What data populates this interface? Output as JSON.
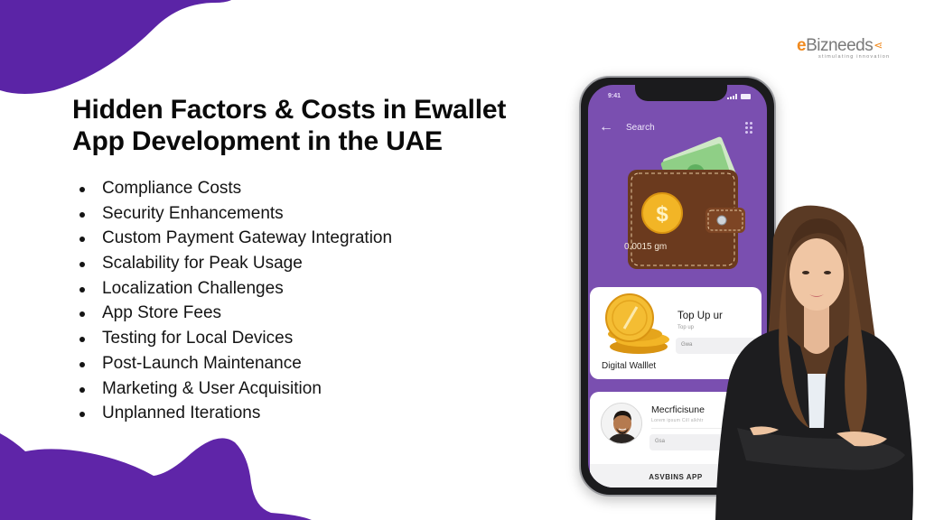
{
  "brand": {
    "name": "eBizneeds",
    "name_prefix": "e",
    "name_rest": "Bizneeds",
    "tagline": "stimulating innovation",
    "accent_color": "#f08a1f",
    "primary_color": "#5b24a6"
  },
  "title": {
    "line1": "Hidden Factors & Costs in Ewallet",
    "line2": "App Development in the UAE"
  },
  "factors": [
    "Compliance Costs",
    "Security Enhancements",
    "Custom Payment Gateway Integration",
    "Scalability for Peak Usage",
    "Localization Challenges",
    "App Store Fees",
    "Testing for Local Devices",
    "Post-Launch Maintenance",
    "Marketing & User Acquisition",
    "Unplanned Iterations"
  ],
  "phone": {
    "status_left": "9:41",
    "nav": {
      "back_icon": "←",
      "title": "Search"
    },
    "wallet_amount": "0.0015 gm",
    "topup_card": {
      "label": "Digital Walllet",
      "title": "Top Up ur",
      "subtitle": "Top up",
      "input_placeholder": "Gwa"
    },
    "profile_card": {
      "name": "Mecrficisune",
      "subtitle": "Lorem ipsum Cill alkhtr",
      "input_placeholder": "Gsa",
      "button": "ASVBINS APP"
    }
  }
}
